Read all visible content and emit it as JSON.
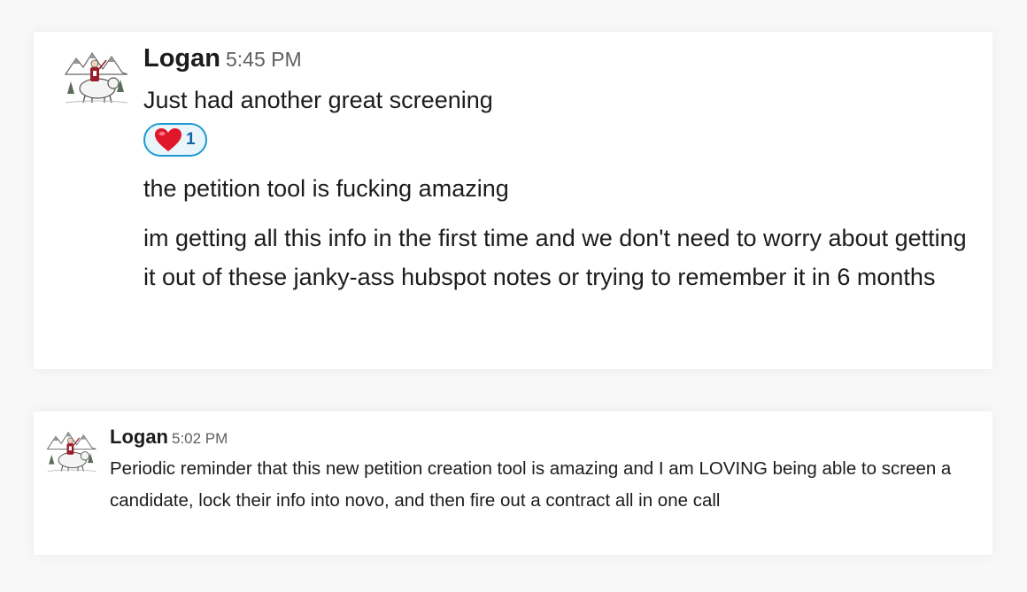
{
  "messages": [
    {
      "author": "Logan",
      "time": "5:45 PM",
      "lines": [
        "Just had another great screening",
        "the petition tool is fucking amazing",
        "im getting all this info in the first time and we don't need to worry about getting it out of these janky-ass hubspot notes or trying to remember it in 6 months"
      ],
      "reaction": {
        "emoji": "heart-emoji",
        "count": "1"
      }
    },
    {
      "author": "Logan",
      "time": "5:02 PM",
      "lines": [
        "Periodic reminder that this new petition creation tool is amazing and I am LOVING being able to screen a candidate, lock their info into novo, and then fire out a contract all in one call"
      ]
    }
  ],
  "colors": {
    "reaction_border": "#1d9bd1",
    "reaction_bg": "#e8f5fa",
    "reaction_count": "#1264a3",
    "timestamp": "#616061"
  }
}
